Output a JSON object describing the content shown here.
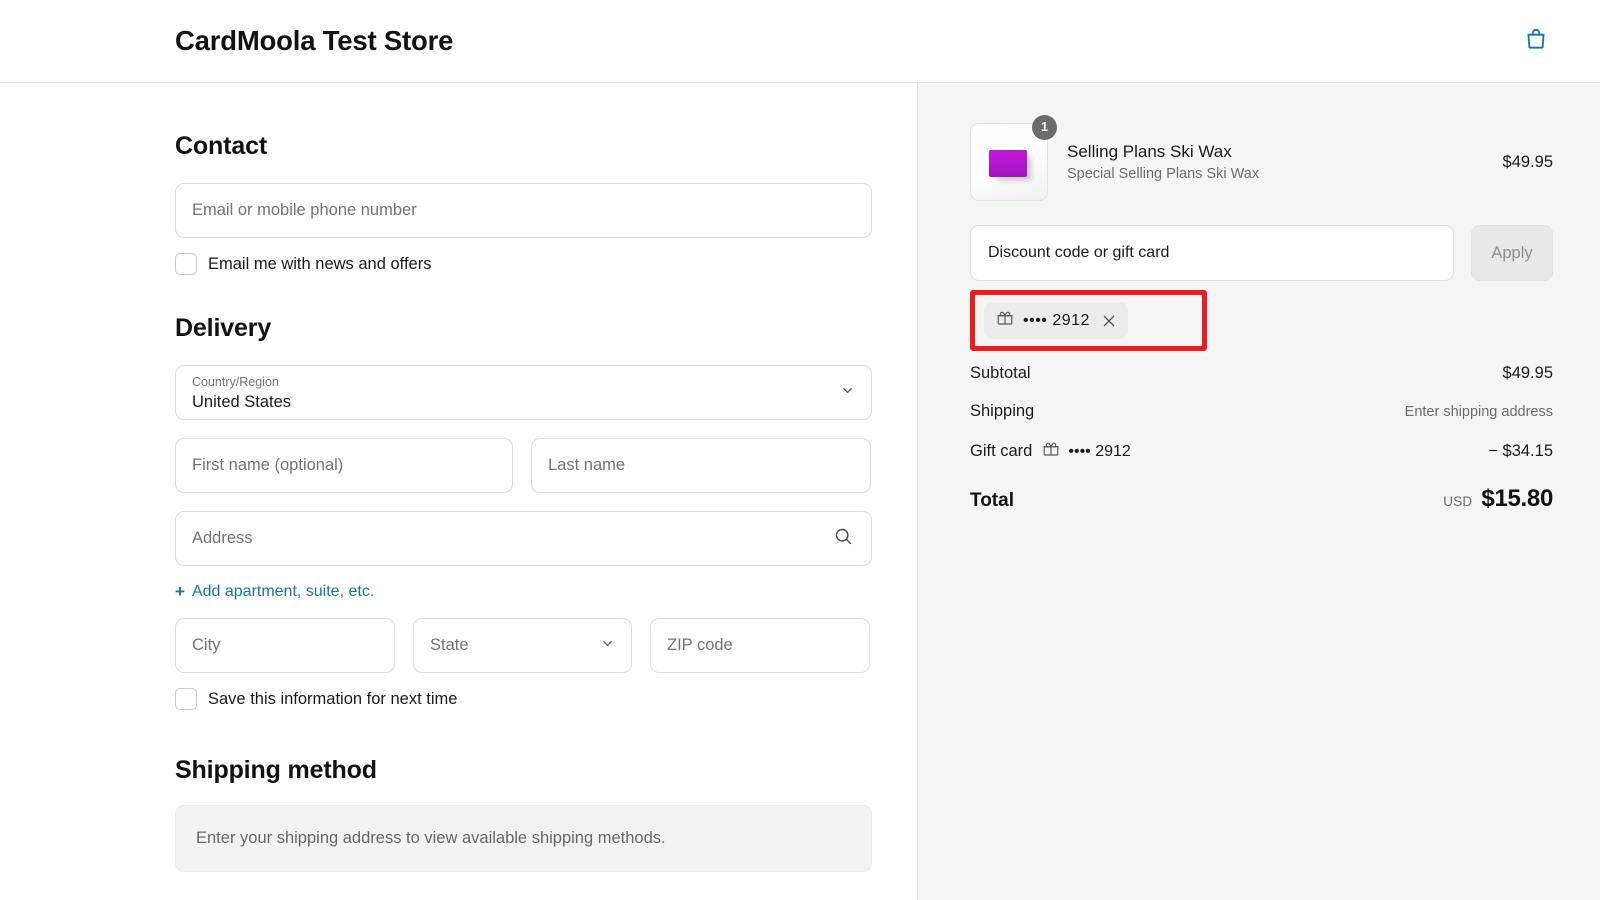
{
  "header": {
    "store_title": "CardMoola Test Store",
    "bag_icon": "shopping-bag-icon"
  },
  "contact": {
    "title": "Contact",
    "email_placeholder": "Email or mobile phone number",
    "email_value": "",
    "newsletter_label": "Email me with news and offers",
    "newsletter_checked": false
  },
  "delivery": {
    "title": "Delivery",
    "country_label": "Country/Region",
    "country_value": "United States",
    "first_name_placeholder": "First name (optional)",
    "first_name_value": "",
    "last_name_placeholder": "Last name",
    "last_name_value": "",
    "address_placeholder": "Address",
    "address_value": "",
    "address_icon": "search-icon",
    "add_apartment_plus": "+",
    "add_apartment_label": "Add apartment, suite, etc.",
    "city_placeholder": "City",
    "city_value": "",
    "state_placeholder": "State",
    "state_value": "",
    "zip_placeholder": "ZIP code",
    "zip_value": "",
    "save_info_label": "Save this information for next time",
    "save_info_checked": false
  },
  "shipping_method": {
    "title": "Shipping method",
    "note": "Enter your shipping address to view available shipping methods."
  },
  "order_summary": {
    "items": [
      {
        "title": "Selling Plans Ski Wax",
        "variant": "Special Selling Plans Ski Wax",
        "quantity": "1",
        "price": "$49.95",
        "image_icon": "product-thumbnail"
      }
    ],
    "discount": {
      "placeholder": "Discount code or gift card",
      "value": "",
      "apply_label": "Apply"
    },
    "applied_gift_card": {
      "icon": "gift-card-icon",
      "masked_number": "•••• 2912",
      "remove_icon": "close-icon",
      "highlight_color": "#ee1c1c"
    },
    "totals": [
      {
        "label": "Subtotal",
        "value": "$49.95",
        "muted": false
      },
      {
        "label": "Shipping",
        "value": "Enter shipping address",
        "muted": true
      }
    ],
    "gift_card_line": {
      "label": "Gift card",
      "masked_number": "•••• 2912",
      "value": "− $34.15"
    },
    "grand_total": {
      "label": "Total",
      "currency": "USD",
      "amount": "$15.80"
    }
  }
}
